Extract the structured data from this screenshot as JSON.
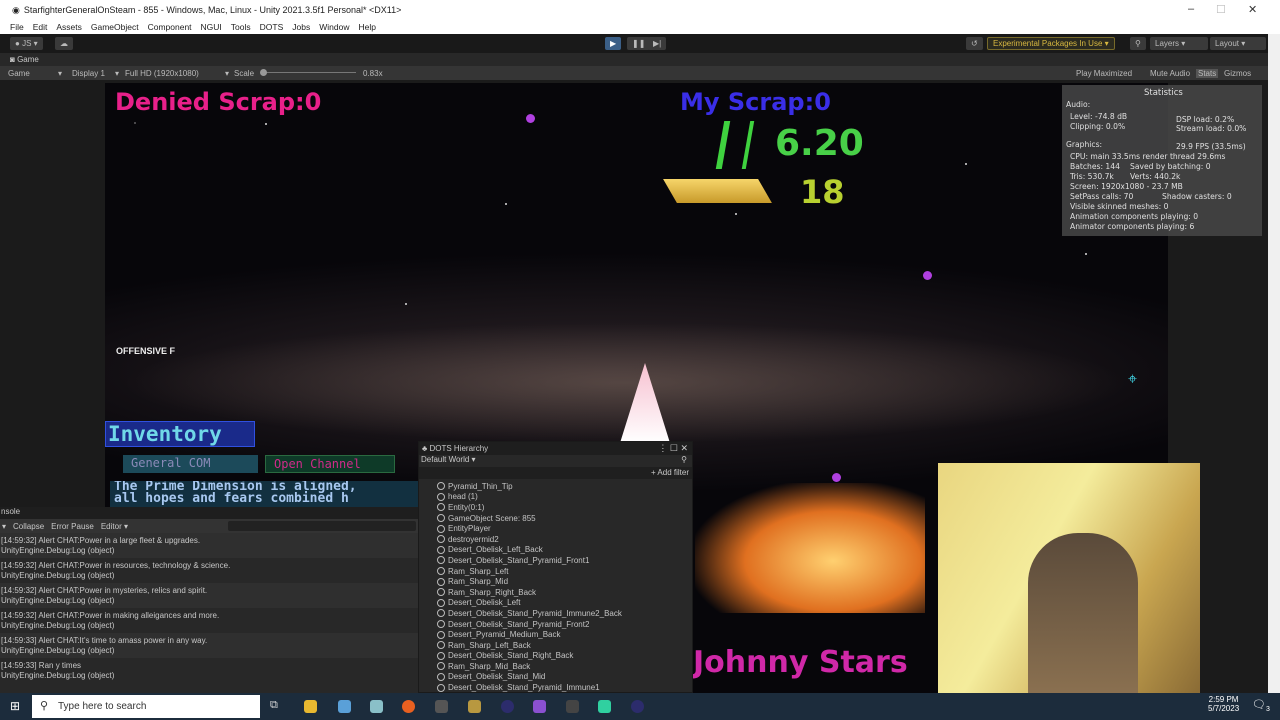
{
  "window": {
    "title": "StarfighterGeneralOnSteam - 855 - Windows, Mac, Linux - Unity 2021.3.5f1 Personal* <DX11>",
    "controls": [
      "–",
      "☐",
      "✕"
    ]
  },
  "menu": [
    "File",
    "Edit",
    "Assets",
    "GameObject",
    "Component",
    "NGUI",
    "Tools",
    "DOTS",
    "Jobs",
    "Window",
    "Help"
  ],
  "toolbar": {
    "account": "JS ▾",
    "experimental": "Experimental Packages In Use ▾",
    "layers": "Layers",
    "layout": "Layout"
  },
  "game_tab": {
    "label": "Game"
  },
  "game_bar": {
    "mode": "Game",
    "display": "Display 1",
    "resolution": "Full HD (1920x1080)",
    "scale_label": "Scale",
    "scale_value": "0.83x",
    "play_maximized": "Play Maximized",
    "mute_audio": "Mute Audio",
    "stats": "Stats",
    "gizmos": "Gizmos"
  },
  "hud": {
    "denied_scrap": "Denied Scrap:0",
    "my_scrap": "My Scrap:0",
    "money": "6.20",
    "gold": "18",
    "offensive": "OFFENSIVE F",
    "inventory": "Inventory",
    "general_com": "General COM",
    "open_channel": "Open Channel",
    "chat_line1": "The Prime Dimension is aligned,",
    "chat_line2": "all hopes and fears combined h",
    "player_name": "Johnny Stars"
  },
  "stats": {
    "title": "Statistics",
    "audio": "Audio:",
    "level": "Level: -74.8 dB",
    "clipping": "Clipping: 0.0%",
    "dsp": "DSP load: 0.2%",
    "stream": "Stream load: 0.0%",
    "graphics": "Graphics:",
    "fps": "29.9 FPS (33.5ms)",
    "cpu": "CPU: main 33.5ms  render thread 29.6ms",
    "batches": "Batches: 144",
    "saved": "Saved by batching: 0",
    "tris": "Tris: 530.7k",
    "verts": "Verts: 440.2k",
    "screen": "Screen: 1920x1080 - 23.7 MB",
    "setpass": "SetPass calls: 70",
    "shadow": "Shadow casters: 0",
    "skinned": "Visible skinned meshes: 0",
    "animation": "Animation components playing: 0",
    "animator": "Animator components playing: 6"
  },
  "console": {
    "tab": "nsole",
    "collapse": "Collapse",
    "error_pause": "Error Pause",
    "editor": "Editor ▾",
    "logs": [
      {
        "msg": "[14:59:32] Alert CHAT:Power in a large fleet & upgrades.",
        "trace": "UnityEngine.Debug:Log (object)"
      },
      {
        "msg": "[14:59:32] Alert CHAT:Power in resources, technology & science.",
        "trace": "UnityEngine.Debug:Log (object)"
      },
      {
        "msg": "[14:59:32] Alert CHAT:Power in mysteries, relics and spirit.",
        "trace": "UnityEngine.Debug:Log (object)"
      },
      {
        "msg": "[14:59:32] Alert CHAT:Power in making alleigances and more.",
        "trace": "UnityEngine.Debug:Log (object)"
      },
      {
        "msg": "[14:59:33] Alert CHAT:It's time to amass power in any way.",
        "trace": "UnityEngine.Debug:Log (object)"
      },
      {
        "msg": "[14:59:33] Ran y times",
        "trace": "UnityEngine.Debug:Log (object)"
      }
    ]
  },
  "dots": {
    "title": "DOTS Hierarchy",
    "world": "Default World ▾",
    "add_filter": "+ Add filter",
    "items": [
      "Pyramid_Thin_Tip",
      "head (1)",
      "Entity(0:1)",
      "GameObject Scene: 855",
      "EntityPlayer",
      "destroyermid2",
      "Desert_Obelisk_Left_Back",
      "Desert_Obelisk_Stand_Pyramid_Front1",
      "Ram_Sharp_Left",
      "Ram_Sharp_Mid",
      "Ram_Sharp_Right_Back",
      "Desert_Obelisk_Left",
      "Desert_Obelisk_Stand_Pyramid_Immune2_Back",
      "Desert_Obelisk_Stand_Pyramid_Front2",
      "Desert_Pyramid_Medium_Back",
      "Ram_Sharp_Left_Back",
      "Desert_Obelisk_Stand_Right_Back",
      "Ram_Sharp_Mid_Back",
      "Desert_Obelisk_Stand_Mid",
      "Desert_Obelisk_Stand_Pyramid_Immune1"
    ]
  },
  "taskbar": {
    "search_placeholder": "Type here to search",
    "time": "2:59 PM",
    "date": "5/7/2023",
    "notifications": "3"
  }
}
